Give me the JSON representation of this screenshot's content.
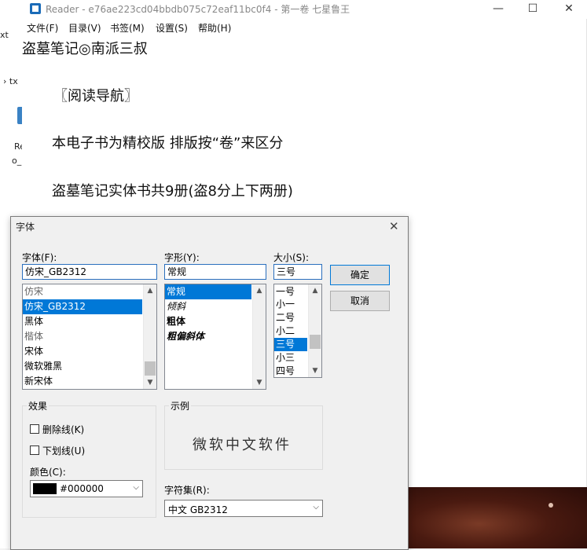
{
  "background_window": {
    "frag_top": "xt",
    "frag_nav": "› tx",
    "frag_re": "Re",
    "frag_o": "o_"
  },
  "reader": {
    "title": "Reader - e76ae223cd04bbdb075c72eaf11bc0f4 - 第一卷 七星鲁王",
    "caption": {
      "minimize": "—",
      "maximize": "☐",
      "close": "✕"
    },
    "menus": [
      "文件(F)",
      "目录(V)",
      "书签(M)",
      "设置(S)",
      "帮助(H)"
    ],
    "lines": [
      "盗墓笔记◎南派三叔",
      "〖阅读导航〗",
      "本电子书为精校版 排版按“卷”来区分",
      "盗墓笔记实体书共9册(盗8分上下两册)"
    ]
  },
  "dialog": {
    "title": "字体",
    "close": "✕",
    "font_label": "字体(F):",
    "font_value": "仿宋_GB2312",
    "fonts": [
      "仿宋",
      "仿宋_GB2312",
      "黑体",
      "楷体",
      "宋体",
      "微软雅黑",
      "新宋体"
    ],
    "style_label": "字形(Y):",
    "style_value": "常规",
    "styles": [
      "常规",
      "倾斜",
      "粗体",
      "粗偏斜体"
    ],
    "size_label": "大小(S):",
    "size_value": "三号",
    "sizes": [
      "一号",
      "小一",
      "二号",
      "小二",
      "三号",
      "小三",
      "四号"
    ],
    "ok": "确定",
    "cancel": "取消",
    "effects_label": "效果",
    "strike_label": "删除线(K)",
    "underline_label": "下划线(U)",
    "color_label": "颜色(C):",
    "color_value": "#000000",
    "color_swatch": "#000000",
    "sample_label": "示例",
    "sample_text": "微软中文软件",
    "charset_label": "字符集(R):",
    "charset_value": "中文 GB2312"
  },
  "colors": {
    "selection": "#0078d7",
    "default_button_border": "#0078d7"
  }
}
